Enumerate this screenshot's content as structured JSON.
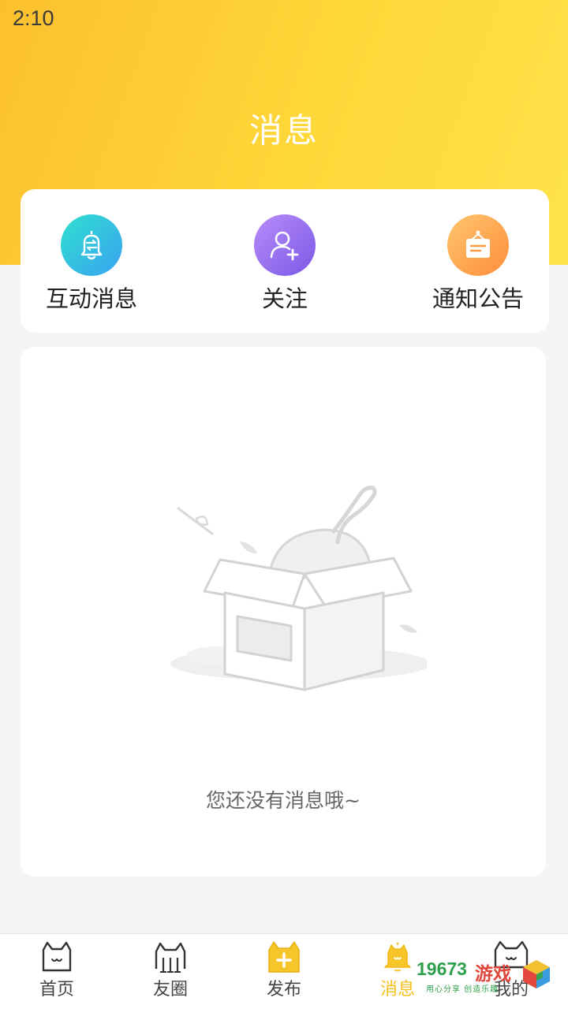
{
  "status_bar": {
    "time": "2:10"
  },
  "header": {
    "title": "消息"
  },
  "quick_actions": [
    {
      "label": "互动消息",
      "icon": "bell-swap-icon",
      "color": "#3aa2f2"
    },
    {
      "label": "关注",
      "icon": "user-plus-icon",
      "color": "#8b67ec"
    },
    {
      "label": "通知公告",
      "icon": "notice-board-icon",
      "color": "#ff9a44"
    }
  ],
  "empty_state": {
    "text": "您还没有消息哦~",
    "illustration": "cat-in-box-icon"
  },
  "tabbar": [
    {
      "label": "首页",
      "icon": "cat-head-icon",
      "active": false
    },
    {
      "label": "友圈",
      "icon": "cat-group-icon",
      "active": false
    },
    {
      "label": "发布",
      "icon": "publish-plus-icon",
      "active": false
    },
    {
      "label": "消息",
      "icon": "bell-icon",
      "active": true
    },
    {
      "label": "我的",
      "icon": "cat-face-icon",
      "active": false
    }
  ],
  "watermark": {
    "number": "19673",
    "word": "游戏",
    "slogan": "用心分享 创造乐趣"
  },
  "colors": {
    "accent": "#f6bf1e",
    "header_start": "#fcc02e",
    "header_end": "#ffe24a"
  }
}
